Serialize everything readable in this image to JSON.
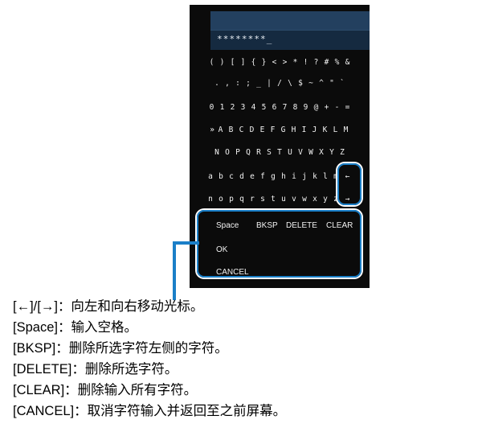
{
  "device": {
    "title_bar": "",
    "input": {
      "value": "********_",
      "placeholder": ""
    },
    "char_rows": [
      [
        "(",
        ")",
        "[",
        "]",
        "{",
        "}",
        "<",
        ">",
        "*",
        "!",
        "?",
        "#",
        "%",
        "&"
      ],
      [
        ".",
        ",",
        ":",
        ";",
        "_",
        "|",
        "/",
        "\\",
        "$",
        "~",
        "^",
        "\"",
        "`"
      ],
      [
        "0",
        "1",
        "2",
        "3",
        "4",
        "5",
        "6",
        "7",
        "8",
        "9",
        "@",
        "+",
        "-",
        "="
      ],
      [
        "A",
        "B",
        "C",
        "D",
        "E",
        "F",
        "G",
        "H",
        "I",
        "J",
        "K",
        "L",
        "M"
      ],
      [
        "N",
        "O",
        "P",
        "Q",
        "R",
        "S",
        "T",
        "U",
        "V",
        "W",
        "X",
        "Y",
        "Z"
      ],
      [
        "a",
        "b",
        "c",
        "d",
        "e",
        "f",
        "g",
        "h",
        "i",
        "j",
        "k",
        "l",
        "m"
      ],
      [
        "n",
        "o",
        "p",
        "q",
        "r",
        "s",
        "t",
        "u",
        "v",
        "w",
        "x",
        "y",
        "z"
      ]
    ],
    "cursor_marker": "»",
    "cursor_row_index": 3,
    "arrow_left": "←",
    "arrow_right": "→",
    "commands": {
      "space": "Space",
      "bksp": "BKSP",
      "delete": "DELETE",
      "clear": "CLEAR",
      "ok": "OK",
      "cancel": "CANCEL"
    }
  },
  "legend": {
    "lines": [
      "[←]/[→]：向左和向右移动光标。",
      "[Space]：输入空格。",
      "[BKSP]：删除所选字符左侧的字符。",
      "[DELETE]：删除所选字符。",
      "[CLEAR]：删除输入所有字符。",
      "[CANCEL]：取消字符输入并返回至之前屏幕。"
    ]
  },
  "colors": {
    "panel_background": "#0b0b0b",
    "title_bar": "#23405f",
    "input_background": "#152a40",
    "text": "#f2f2f2",
    "highlight": "#1a7fc8",
    "legend_text": "#000000"
  }
}
